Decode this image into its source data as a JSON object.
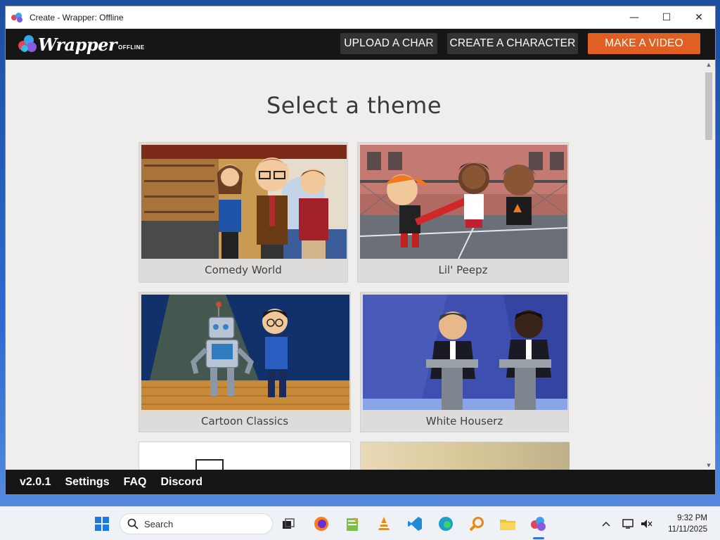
{
  "window": {
    "title": "Create - Wrapper: Offline",
    "controls": {
      "minimize": "—",
      "maximize": "☐",
      "close": "✕"
    }
  },
  "nav": {
    "logo_text": "Wrapper",
    "logo_sub": "OFFLINE",
    "buttons": [
      "UPLOAD A CHAR",
      "CREATE A CHARACTER",
      "MAKE A VIDEO"
    ]
  },
  "main": {
    "heading": "Select a theme",
    "themes": [
      {
        "label": "Comedy World"
      },
      {
        "label": "Lil' Peepz"
      },
      {
        "label": "Cartoon Classics"
      },
      {
        "label": "White Houserz"
      }
    ]
  },
  "footer": {
    "version": "v2.0.1",
    "links": [
      "Settings",
      "FAQ",
      "Discord"
    ]
  },
  "taskbar": {
    "search_label": "Search",
    "time": "9:32 PM",
    "date": "11/11/2025"
  },
  "colors": {
    "accent": "#e05f22",
    "nav_bg": "#161616",
    "nav_button": "#333333",
    "page_bg": "#efeeec"
  }
}
